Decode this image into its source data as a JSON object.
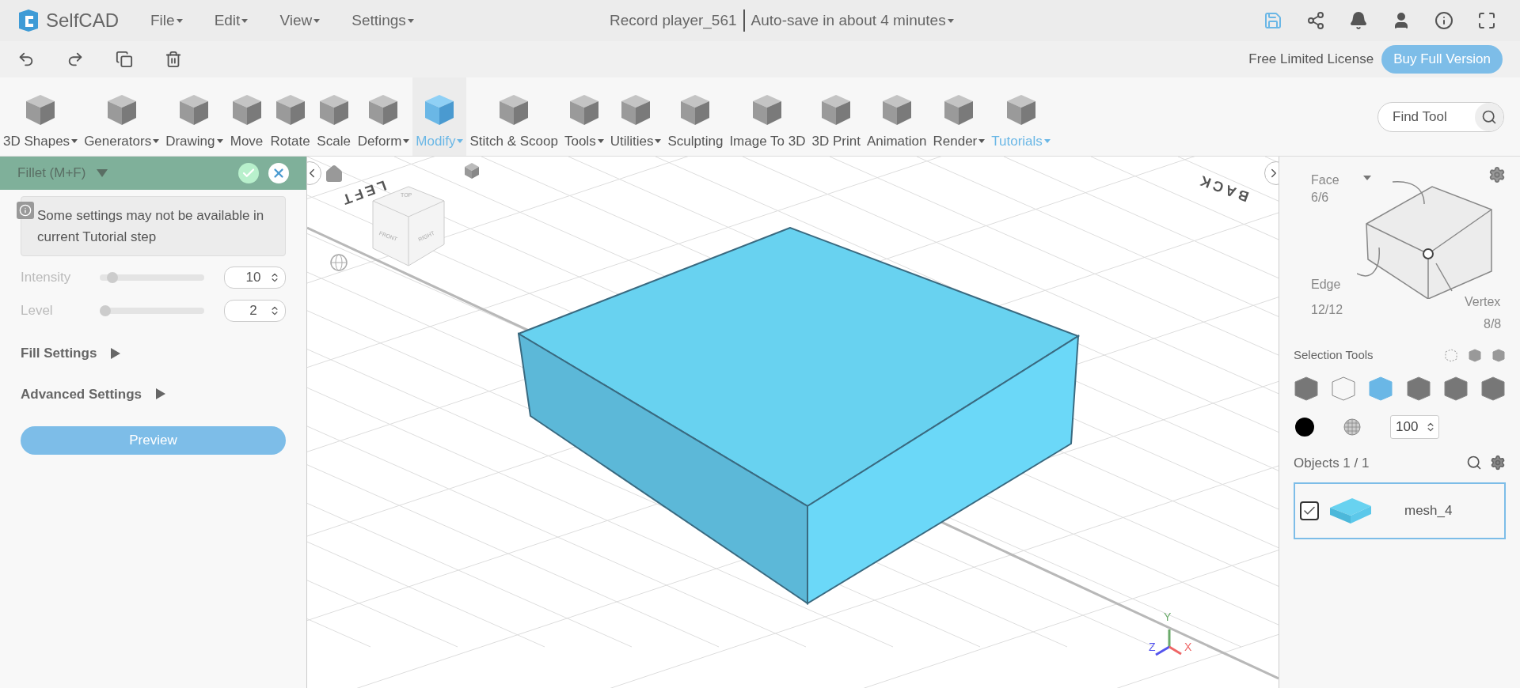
{
  "header": {
    "logo": "SelfCAD",
    "menus": [
      {
        "label": "File"
      },
      {
        "label": "Edit"
      },
      {
        "label": "View"
      },
      {
        "label": "Settings"
      }
    ],
    "document_title": "Record player_561",
    "autosave": "Auto-save in about 4 minutes"
  },
  "license": {
    "text": "Free Limited License",
    "button": "Buy Full Version"
  },
  "tools": [
    {
      "label": "3D Shapes",
      "caret": true,
      "selected": false,
      "highlighted": false
    },
    {
      "label": "Generators",
      "caret": true,
      "selected": false,
      "highlighted": false
    },
    {
      "label": "Drawing",
      "caret": true,
      "selected": false,
      "highlighted": false
    },
    {
      "label": "Move",
      "caret": false,
      "selected": false,
      "highlighted": false
    },
    {
      "label": "Rotate",
      "caret": false,
      "selected": false,
      "highlighted": false
    },
    {
      "label": "Scale",
      "caret": false,
      "selected": false,
      "highlighted": false
    },
    {
      "label": "Deform",
      "caret": true,
      "selected": false,
      "highlighted": false
    },
    {
      "label": "Modify",
      "caret": true,
      "selected": true,
      "highlighted": true
    },
    {
      "label": "Stitch & Scoop",
      "caret": false,
      "selected": false,
      "highlighted": false
    },
    {
      "label": "Tools",
      "caret": true,
      "selected": false,
      "highlighted": false
    },
    {
      "label": "Utilities",
      "caret": true,
      "selected": false,
      "highlighted": false
    },
    {
      "label": "Sculpting",
      "caret": false,
      "selected": false,
      "highlighted": false
    },
    {
      "label": "Image To 3D",
      "caret": false,
      "selected": false,
      "highlighted": false
    },
    {
      "label": "3D Print",
      "caret": false,
      "selected": false,
      "highlighted": false
    },
    {
      "label": "Animation",
      "caret": false,
      "selected": false,
      "highlighted": false
    },
    {
      "label": "Render",
      "caret": true,
      "selected": false,
      "highlighted": false
    },
    {
      "label": "Tutorials",
      "caret": true,
      "selected": false,
      "highlighted": true
    }
  ],
  "find_tool": {
    "placeholder": "Find Tool"
  },
  "panel": {
    "title": "Fillet (M+F)",
    "notice": "Some settings may not be available in current Tutorial step",
    "sliders": [
      {
        "label": "Intensity",
        "level": 0.08,
        "value": "10"
      },
      {
        "label": "Level",
        "level": 0.0,
        "value": "2"
      }
    ],
    "sections": [
      {
        "label": "Fill Settings",
        "expanded": false
      },
      {
        "label": "Advanced Settings",
        "expanded": false
      }
    ],
    "preview_button": "Preview"
  },
  "viewport": {
    "view_labels": [
      "LEFT",
      "BACK"
    ],
    "cube_faces": [
      "TOP",
      "FRONT",
      "RIGHT"
    ],
    "axes": [
      "Y",
      "Z",
      "X"
    ]
  },
  "selection": {
    "face_label": "Face",
    "face_count": "6/6",
    "edge_label": "Edge",
    "edge_count": "12/12",
    "vertex_label": "Vertex",
    "vertex_count": "8/8",
    "tools_label": "Selection Tools",
    "opacity": "100"
  },
  "objects": {
    "header": "Objects 1 / 1",
    "items": [
      {
        "name": "mesh_4",
        "checked": true,
        "selected": true
      }
    ]
  }
}
